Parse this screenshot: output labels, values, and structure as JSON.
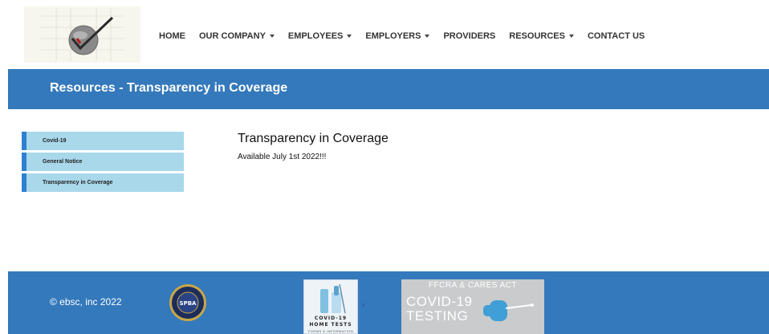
{
  "header": {
    "logo_icon": "checkmark-globe-logo",
    "nav": [
      {
        "label": "HOME",
        "dropdown": false
      },
      {
        "label": "OUR COMPANY",
        "dropdown": true
      },
      {
        "label": "EMPLOYEES",
        "dropdown": true
      },
      {
        "label": "EMPLOYERS",
        "dropdown": true
      },
      {
        "label": "PROVIDERS",
        "dropdown": false
      },
      {
        "label": "RESOURCES",
        "dropdown": true
      },
      {
        "label": "CONTACT US",
        "dropdown": false
      }
    ]
  },
  "banner": {
    "title": "Resources - Transparency in Coverage"
  },
  "sidebar": {
    "items": [
      {
        "label": "Covid-19"
      },
      {
        "label": "General Notice"
      },
      {
        "label": "Transparency in Coverage"
      }
    ]
  },
  "content": {
    "title": "Transparency in Coverage",
    "text": "Available July 1st 2022!!!"
  },
  "footer": {
    "copyright": "© ebsc, inc 2022",
    "badges": {
      "seal_text": "SPBA",
      "home_tests": {
        "line1": "COVID-19",
        "line2": "HOME TESTS",
        "line3": "FORMS & INFORMATION"
      },
      "ffcra": {
        "top": "FFCRA & CARES ACT",
        "line1": "COVID-19",
        "line2": "TESTING"
      }
    }
  },
  "colors": {
    "brand_blue": "#3479bb",
    "sidebar_bg": "#a9d8eb",
    "sidebar_accent": "#2f80d0"
  }
}
